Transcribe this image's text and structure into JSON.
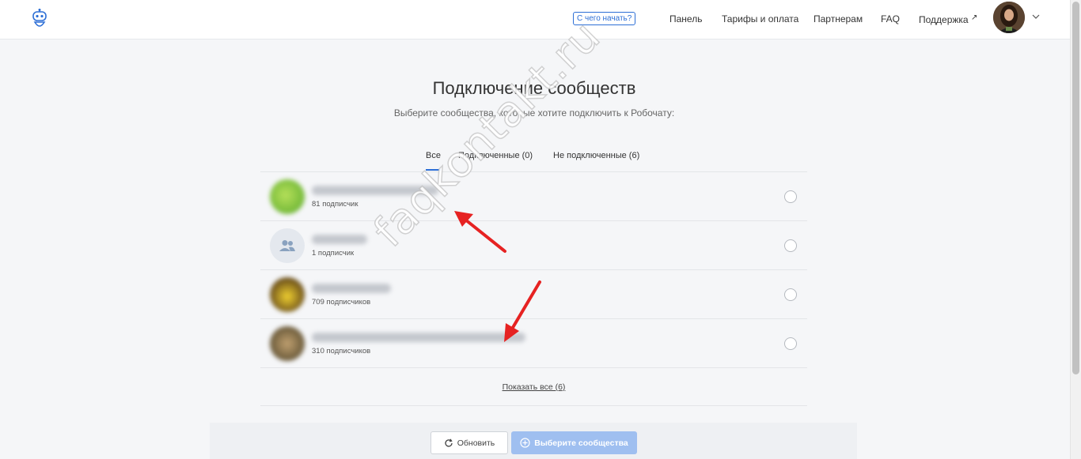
{
  "header": {
    "start_label": "С чего начать?",
    "nav": [
      {
        "label": "Панель"
      },
      {
        "label": "Тарифы и оплата"
      },
      {
        "label": "Партнерам"
      },
      {
        "label": "FAQ"
      },
      {
        "label": "Поддержка",
        "icon": "external-link-icon"
      }
    ],
    "avatar": "user-avatar",
    "menu_icon": "chevron-down-icon"
  },
  "page": {
    "title": "Подключение сообществ",
    "subtitle": "Выберите сообщества, которые хотите подключить к Робочату:"
  },
  "tabs": [
    {
      "label": "Все",
      "active": true
    },
    {
      "label": "Подключенные (0)",
      "active": false
    },
    {
      "label": "Не подключенные (6)",
      "active": false
    }
  ],
  "communities": [
    {
      "subscribers": "81 подписчик",
      "avatar_color": "#7bc043",
      "selected": false
    },
    {
      "subscribers": "1 подписчик",
      "avatar_icon": "group-icon",
      "selected": false
    },
    {
      "subscribers": "709 подписчиков",
      "avatar_color": "#c9a31d",
      "selected": false
    },
    {
      "subscribers": "310 подписчиков",
      "avatar_color": "#8a7a5a",
      "selected": false
    }
  ],
  "show_all": "Показать все (6)",
  "footer": {
    "refresh_label": "Обновить",
    "select_label": "Выберите сообщества"
  },
  "watermark": "faqkontakt.ru",
  "colors": {
    "accent": "#2d6fd6",
    "primary_disabled": "#9fbff0",
    "annotation_arrow": "#e62222"
  }
}
